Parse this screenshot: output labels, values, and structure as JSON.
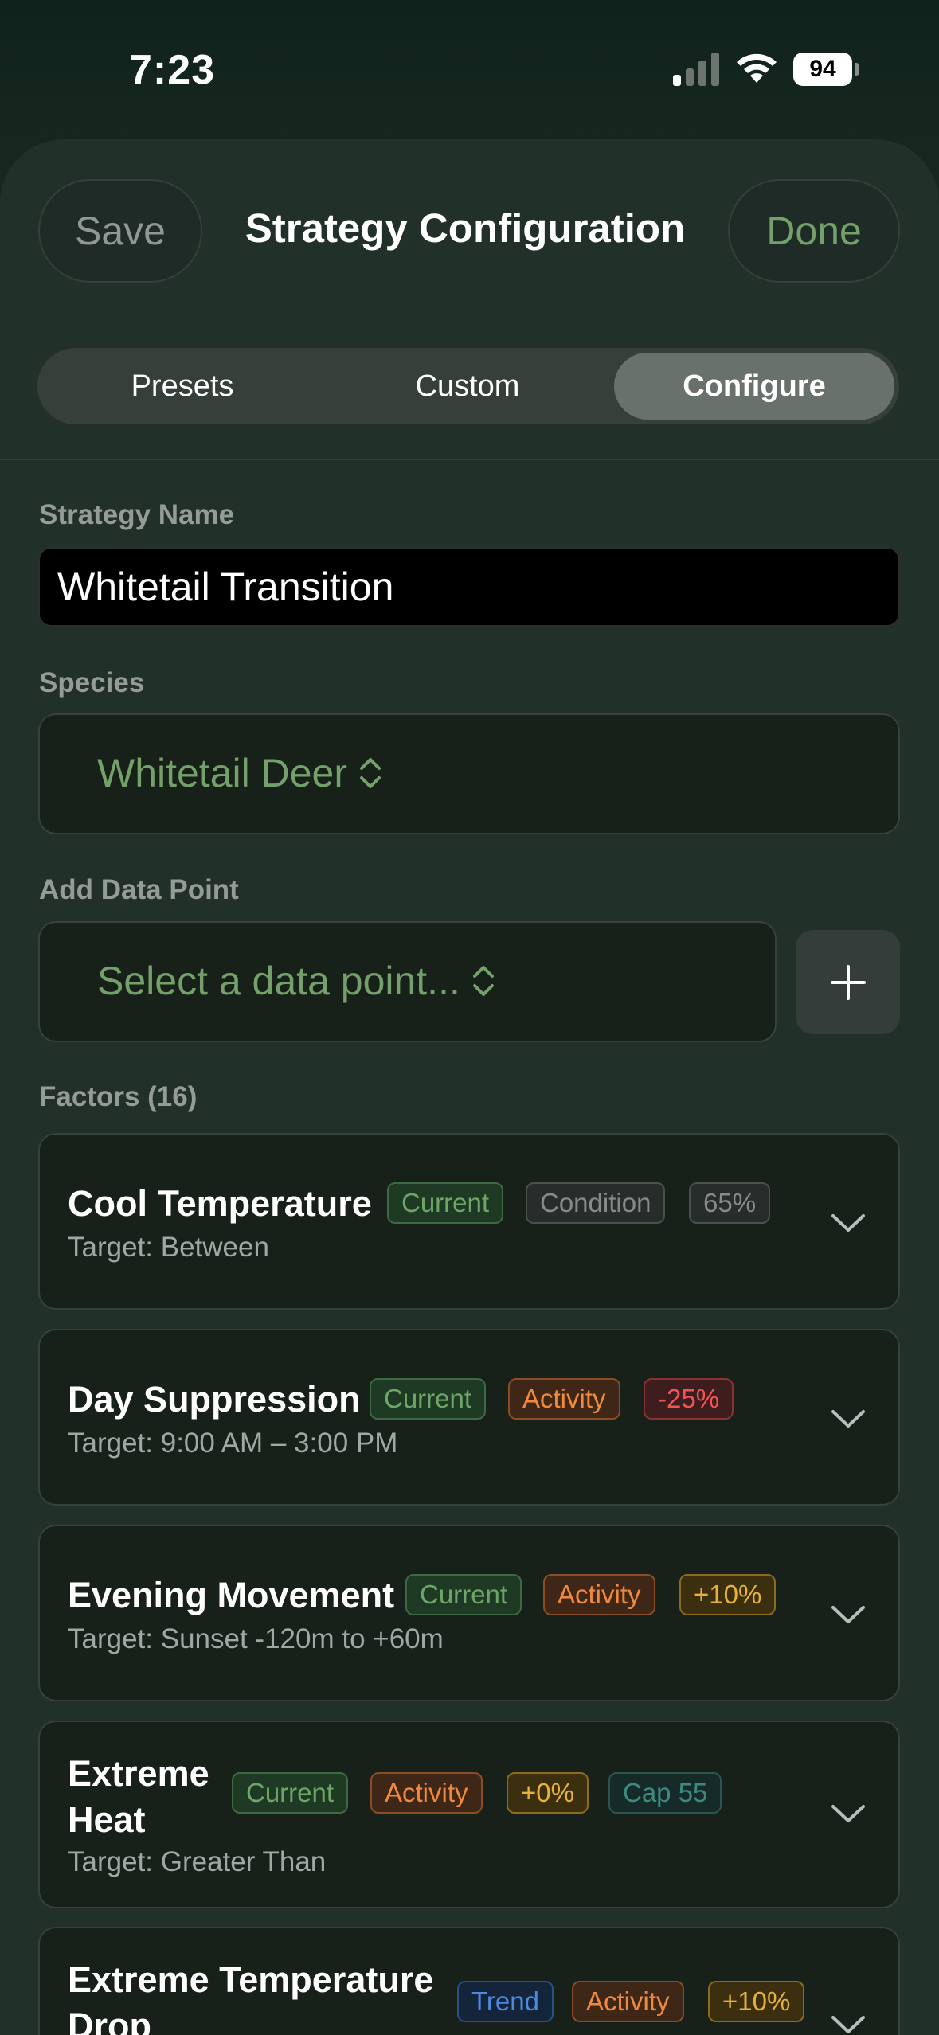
{
  "status_bar": {
    "time": "7:23",
    "battery": "94"
  },
  "header": {
    "save_label": "Save",
    "title": "Strategy Configuration",
    "done_label": "Done"
  },
  "tabs": [
    {
      "label": "Presets",
      "active": false
    },
    {
      "label": "Custom",
      "active": false
    },
    {
      "label": "Configure",
      "active": true
    }
  ],
  "strategy_name": {
    "label": "Strategy Name",
    "value": "Whitetail Transition"
  },
  "species": {
    "label": "Species",
    "value": "Whitetail Deer"
  },
  "data_point": {
    "label": "Add Data Point",
    "placeholder": "Select a data point..."
  },
  "factors": {
    "label": "Factors (16)",
    "items": [
      {
        "title": "Cool Temperature",
        "target": "Target: Between",
        "badges": [
          {
            "text": "Current",
            "style": "green"
          },
          {
            "text": "Condition",
            "style": "gray"
          },
          {
            "text": "65%",
            "style": "gray"
          }
        ]
      },
      {
        "title": "Day Suppression",
        "target": "Target: 9:00 AM – 3:00 PM",
        "badges": [
          {
            "text": "Current",
            "style": "green"
          },
          {
            "text": "Activity",
            "style": "orange"
          },
          {
            "text": "-25%",
            "style": "red"
          }
        ]
      },
      {
        "title": "Evening Movement",
        "target": "Target: Sunset -120m to +60m",
        "badges": [
          {
            "text": "Current",
            "style": "green"
          },
          {
            "text": "Activity",
            "style": "orange"
          },
          {
            "text": "+10%",
            "style": "yellow"
          }
        ]
      },
      {
        "title_line1": "Extreme",
        "title_line2": "Heat",
        "target": "Target: Greater Than",
        "badges": [
          {
            "text": "Current",
            "style": "green"
          },
          {
            "text": "Activity",
            "style": "orange"
          },
          {
            "text": "+0%",
            "style": "yellow"
          },
          {
            "text": "Cap 55",
            "style": "teal"
          }
        ]
      },
      {
        "title_line1": "Extreme Temperature",
        "title_line2": "Drop",
        "badges": [
          {
            "text": "Trend",
            "style": "blue"
          },
          {
            "text": "Activity",
            "style": "orange"
          },
          {
            "text": "+10%",
            "style": "yellow"
          }
        ]
      }
    ]
  },
  "colors": {
    "accent_green": "#74a169",
    "background": "#22302a",
    "card": "#172019"
  }
}
